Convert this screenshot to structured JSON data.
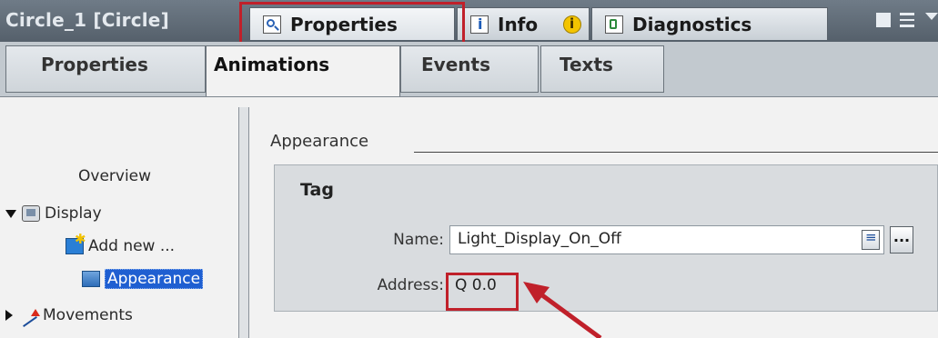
{
  "window": {
    "object_title": "Circle_1 [Circle]",
    "tabs": [
      {
        "label": "Properties",
        "icon": "properties-icon",
        "active": true
      },
      {
        "label": "Info",
        "icon": "info-icon",
        "badge_icon": "info-badge-icon"
      },
      {
        "label": "Diagnostics",
        "icon": "diagnostics-icon"
      }
    ]
  },
  "subtabs": [
    {
      "label": "Properties"
    },
    {
      "label": "Animations",
      "active": true
    },
    {
      "label": "Events"
    },
    {
      "label": "Texts"
    }
  ],
  "tree": {
    "overview": "Overview",
    "display": "Display",
    "add_new": "Add new ...",
    "appearance": "Appearance",
    "movements": "Movements"
  },
  "main": {
    "section_title": "Appearance",
    "group_title": "Tag",
    "name_label": "Name:",
    "name_value": "Light_Display_On_Off",
    "browse_label": "...",
    "address_label": "Address:",
    "address_value": "Q 0.0"
  },
  "colors": {
    "highlight": "#c0202a",
    "selection": "#1f5fd1",
    "title_bar": "#5f6a75"
  }
}
